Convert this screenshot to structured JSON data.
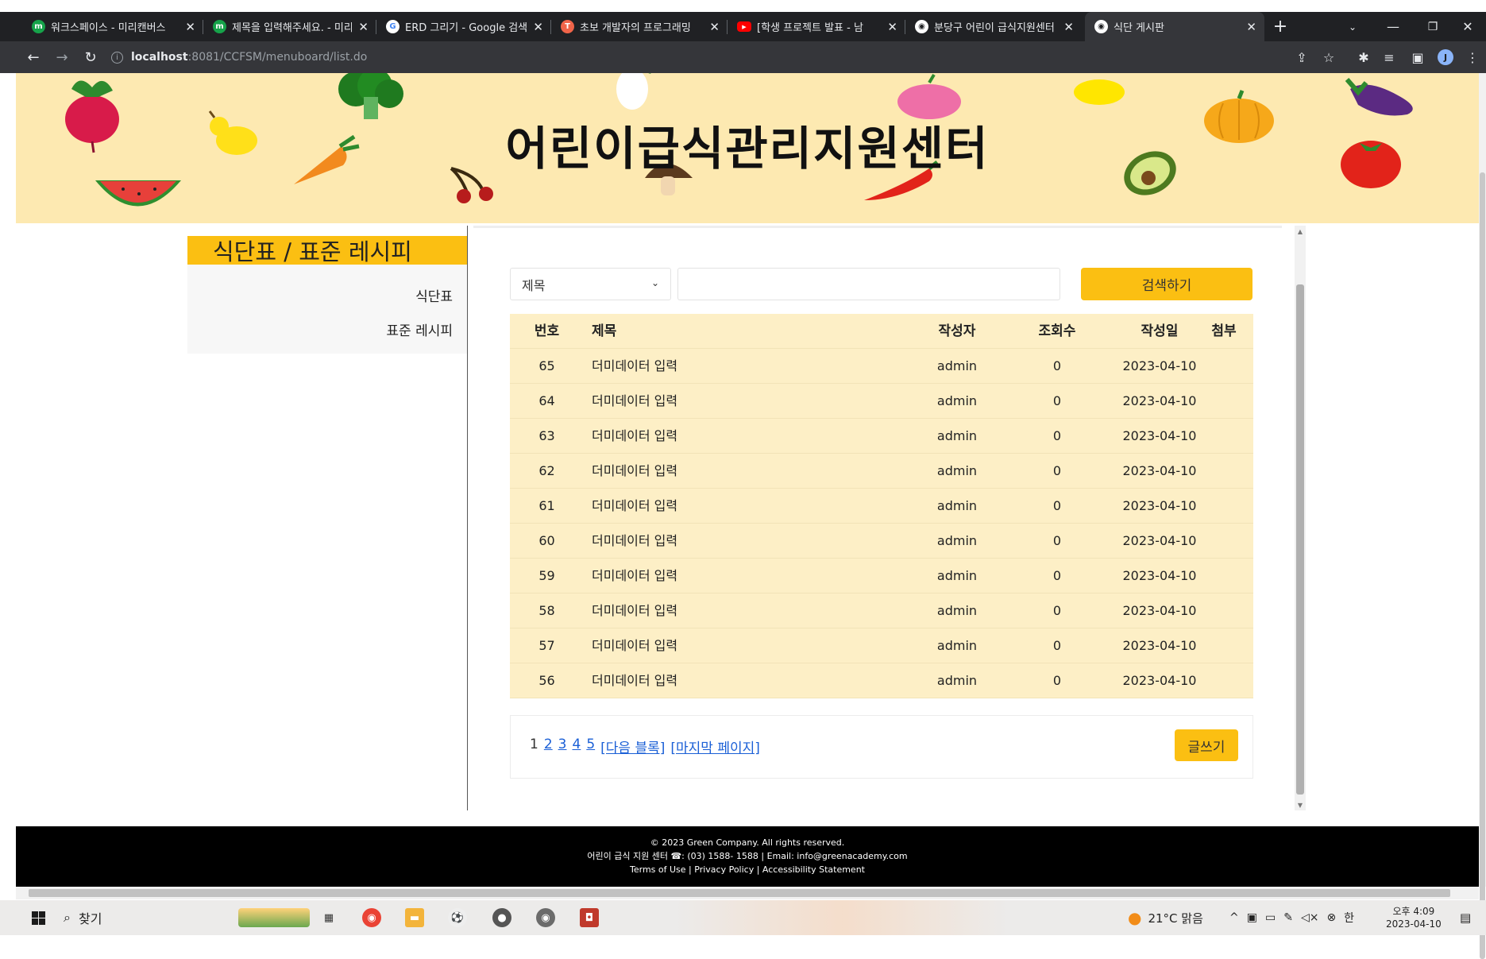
{
  "browser": {
    "tabs": [
      {
        "title": "워크스페이스 - 미리캔버스",
        "favicon": "miricanvas-icon",
        "color": "#16a34a"
      },
      {
        "title": "제목을 입력해주세요. - 미리캔버스",
        "favicon": "miricanvas-icon",
        "color": "#16a34a"
      },
      {
        "title": "ERD 그리기 - Google 검색",
        "favicon": "google-icon",
        "color": "#ffffff"
      },
      {
        "title": "초보 개발자의 프로그래밍",
        "favicon": "tistory-icon",
        "color": "#f06449"
      },
      {
        "title": "[학생 프로젝트 발표 - 남",
        "favicon": "youtube-icon",
        "color": "#ff0000"
      },
      {
        "title": "분당구 어린이 급식지원센터",
        "favicon": "globe-icon",
        "color": "#ffffff"
      },
      {
        "title": "식단 게시판",
        "favicon": "globe-icon",
        "color": "#ffffff",
        "active": true
      }
    ],
    "url_host": "localhost",
    "url_path": ":8081/CCFSM/menuboard/list.do"
  },
  "banner": {
    "title": "어린이급식관리지원센터"
  },
  "sidebar": {
    "heading": "식단표 / 표준 레시피",
    "items": [
      {
        "label": "식단표"
      },
      {
        "label": "표준 레시피"
      }
    ]
  },
  "search": {
    "select_value": "제목",
    "input_value": "",
    "button_label": "검색하기"
  },
  "board": {
    "columns": {
      "no": "번호",
      "title": "제목",
      "writer": "작성자",
      "views": "조회수",
      "date": "작성일",
      "attach": "첨부"
    },
    "rows": [
      {
        "no": "65",
        "title": "더미데이터 입력",
        "writer": "admin",
        "views": "0",
        "date": "2023-04-10",
        "attach": ""
      },
      {
        "no": "64",
        "title": "더미데이터 입력",
        "writer": "admin",
        "views": "0",
        "date": "2023-04-10",
        "attach": ""
      },
      {
        "no": "63",
        "title": "더미데이터 입력",
        "writer": "admin",
        "views": "0",
        "date": "2023-04-10",
        "attach": ""
      },
      {
        "no": "62",
        "title": "더미데이터 입력",
        "writer": "admin",
        "views": "0",
        "date": "2023-04-10",
        "attach": ""
      },
      {
        "no": "61",
        "title": "더미데이터 입력",
        "writer": "admin",
        "views": "0",
        "date": "2023-04-10",
        "attach": ""
      },
      {
        "no": "60",
        "title": "더미데이터 입력",
        "writer": "admin",
        "views": "0",
        "date": "2023-04-10",
        "attach": ""
      },
      {
        "no": "59",
        "title": "더미데이터 입력",
        "writer": "admin",
        "views": "0",
        "date": "2023-04-10",
        "attach": ""
      },
      {
        "no": "58",
        "title": "더미데이터 입력",
        "writer": "admin",
        "views": "0",
        "date": "2023-04-10",
        "attach": ""
      },
      {
        "no": "57",
        "title": "더미데이터 입력",
        "writer": "admin",
        "views": "0",
        "date": "2023-04-10",
        "attach": ""
      },
      {
        "no": "56",
        "title": "더미데이터 입력",
        "writer": "admin",
        "views": "0",
        "date": "2023-04-10",
        "attach": ""
      }
    ]
  },
  "pagination": {
    "current": "1",
    "pages": [
      "2",
      "3",
      "4",
      "5"
    ],
    "next_block": "[다음 블록]",
    "last_page": "[마지막 페이지]"
  },
  "write_button": "글쓰기",
  "footer": {
    "line1": "© 2023 Green Company. All rights reserved.",
    "line2": "어린이 급식 지원 센터 ☎: (03) 1588- 1588 | Email: info@greenacademy.com",
    "line3": "Terms of Use | Privacy Policy | Accessibility Statement"
  },
  "taskbar": {
    "search_label": "찾기",
    "weather": "21°C 맑음",
    "ime": "한",
    "time": "오후 4:09",
    "date": "2023-04-10"
  },
  "colors": {
    "accent": "#fbbf12",
    "banner_bg": "#fde9b1",
    "table_bg": "#fdefc6",
    "link": "#1a5fd6"
  }
}
